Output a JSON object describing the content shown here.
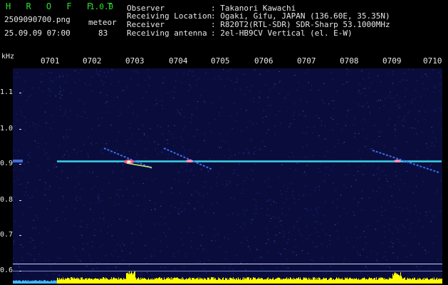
{
  "header": {
    "logo": "H R O F F T",
    "version": "1.0.0",
    "filename": "2509090700.png",
    "datetime": "25.09.09 07:00",
    "meteor_label": "meteor",
    "meteor_count": "83",
    "observer_label": "Observer",
    "observer_value": ": Takanori Kawachi",
    "location_label": "Receiving Location",
    "location_value": ": Ogaki, Gifu, JAPAN (136.60E, 35.35N)",
    "receiver_label": "Receiver",
    "receiver_value": ": R820T2(RTL-SDR) SDR-Sharp 53.1000MHz",
    "antenna_label": "Receiving antenna",
    "antenna_value": ": 2el-HB9CV Vertical (el. E-W)"
  },
  "axis": {
    "y_unit": "kHz",
    "y_ticks": [
      "1.1",
      "1.0",
      "0.9",
      "0.8",
      "0.7",
      "0.6"
    ],
    "x_ticks": [
      "0701",
      "0702",
      "0703",
      "0704",
      "0705",
      "0706",
      "0707",
      "0708",
      "0709",
      "0710"
    ]
  },
  "colors": {
    "background": "#000000",
    "spectrogram_bg": "#0a0d3c",
    "carrier": "#3fd0d8",
    "header_green": "#2fe02f",
    "audio_baseline": "#ffff00",
    "audio_low": "#3fb8ff"
  }
}
